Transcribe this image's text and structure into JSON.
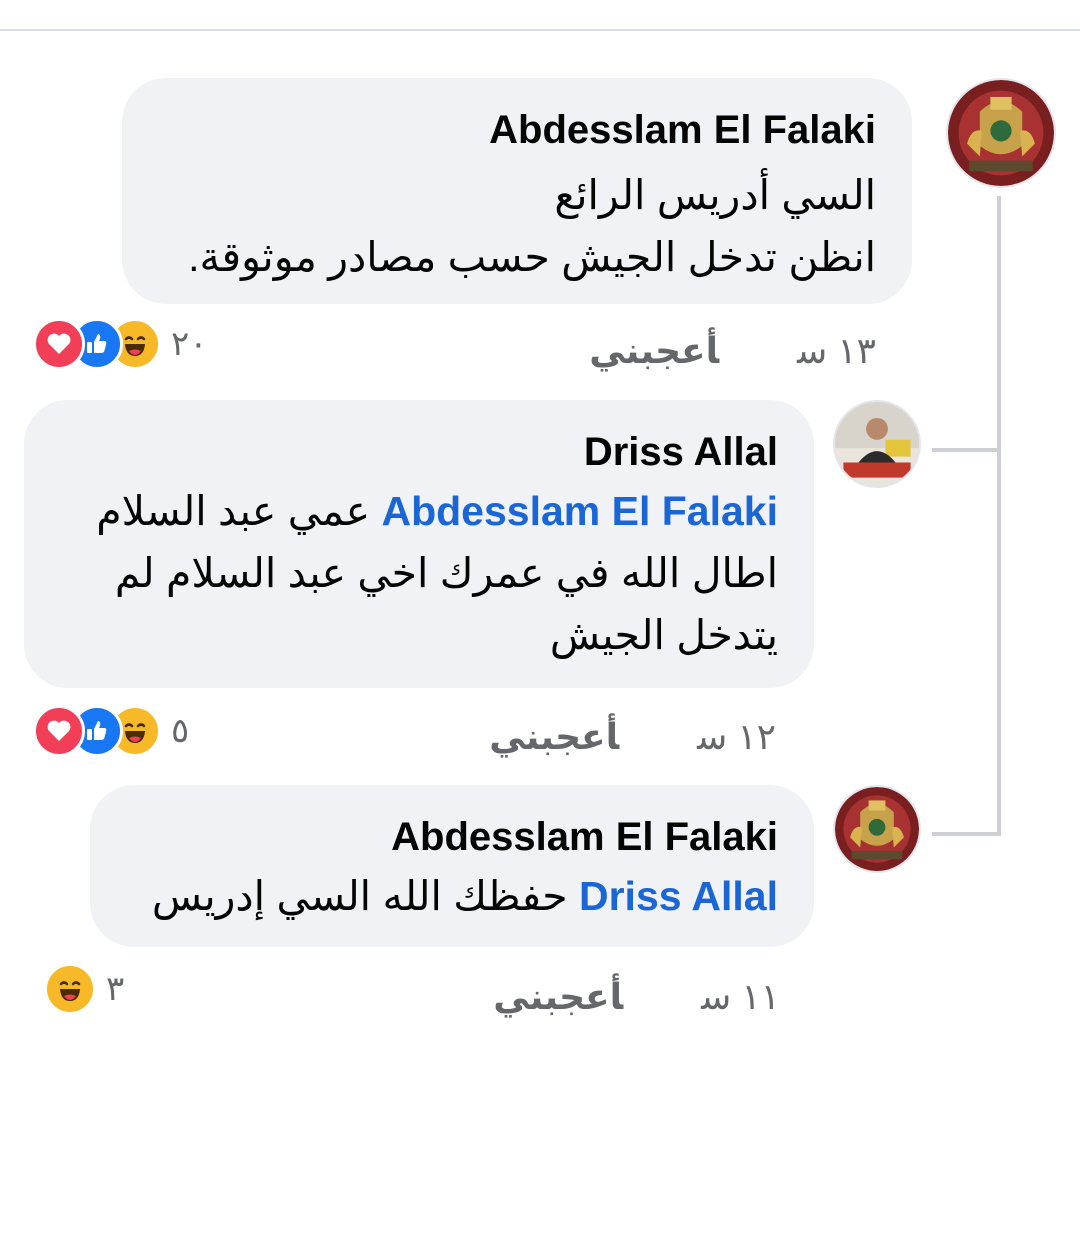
{
  "comments": [
    {
      "author": "Abdesslam El Falaki",
      "lines": [
        "السي أدريس الرائع",
        "انظن تدخل الجيش حسب مصادر موثوقة."
      ],
      "time": "١٣ س",
      "like_label": "أعجبني",
      "reaction_count": "٢٠",
      "reactions": [
        "haha-icon",
        "like-icon",
        "love-icon"
      ]
    },
    {
      "author": "Driss Allal",
      "mention": "Abdesslam El Falaki",
      "lines": [
        "عمي عبد السلام",
        "اطال الله في عمرك اخي عبد السلام لم",
        "يتدخل الجيش"
      ],
      "time": "١٢ س",
      "like_label": "أعجبني",
      "reaction_count": "٥",
      "reactions": [
        "haha-icon",
        "like-icon",
        "love-icon"
      ]
    },
    {
      "author": "Abdesslam El Falaki",
      "mention": "Driss Allal",
      "lines": [
        "حفظك الله السي إدريس"
      ],
      "time": "١١ س",
      "like_label": "أعجبني",
      "reaction_count": "٣",
      "reactions": [
        "haha-icon"
      ]
    }
  ],
  "colors": {
    "bubble": "#f0f2f5",
    "mention": "#1a66d6",
    "meta": "#65676b",
    "love": "#f33e58",
    "like": "#1877f2",
    "haha": "#f7b928"
  }
}
